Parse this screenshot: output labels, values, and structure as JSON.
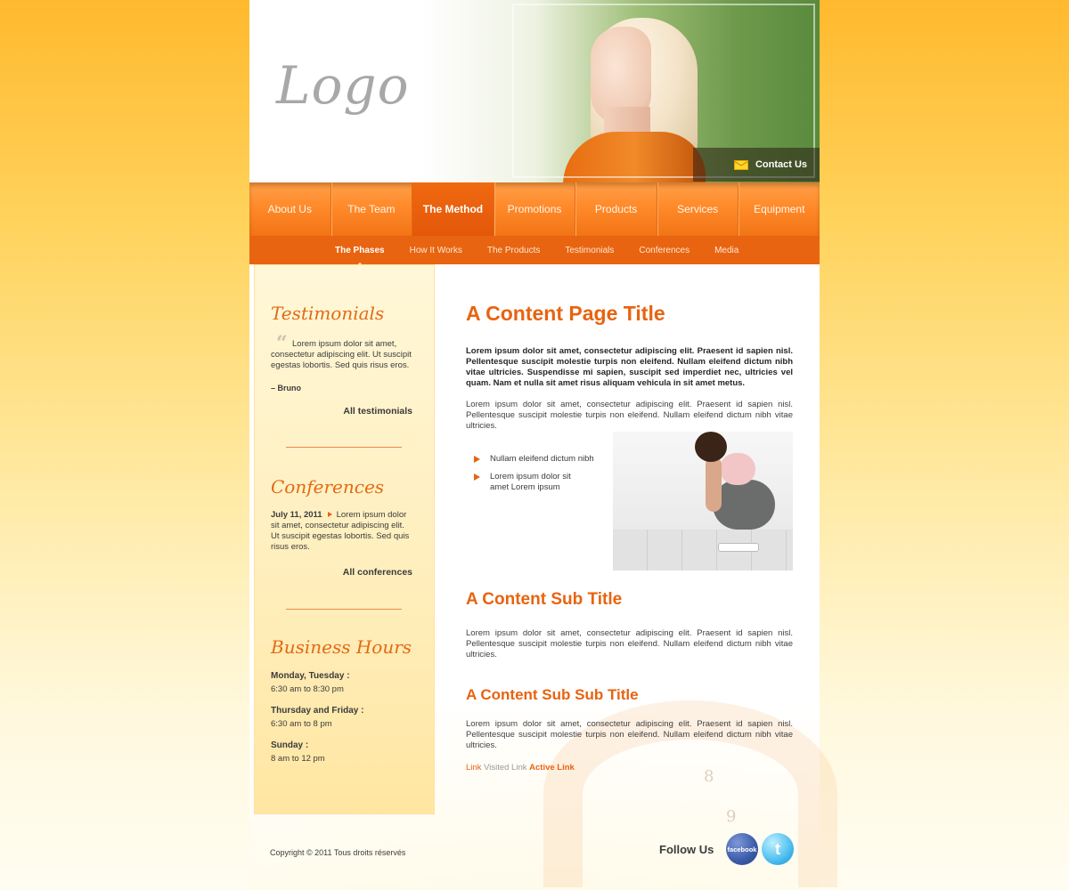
{
  "header": {
    "logo": "Logo",
    "contact_label": "Contact Us"
  },
  "nav": {
    "items": [
      {
        "label": "About Us"
      },
      {
        "label": "The Team"
      },
      {
        "label": "The Method"
      },
      {
        "label": "Promotions"
      },
      {
        "label": "Products"
      },
      {
        "label": "Services"
      },
      {
        "label": "Equipment"
      }
    ],
    "active": "The Method"
  },
  "subnav": {
    "items": [
      {
        "label": "The Phases"
      },
      {
        "label": "How It Works"
      },
      {
        "label": "The Products"
      },
      {
        "label": "Testimonials"
      },
      {
        "label": "Conferences"
      },
      {
        "label": "Media"
      }
    ],
    "active": "The Phases"
  },
  "sidebar": {
    "testimonials": {
      "title": "Testimonials",
      "quote_mark": "“",
      "text": "Lorem ipsum dolor sit amet, consectetur adipiscing elit. Ut suscipit egestas lobortis. Sed quis risus eros.",
      "author": "– Bruno",
      "link": "All testimonials"
    },
    "conferences": {
      "title": "Conferences",
      "date": "July 11, 2011",
      "text": "Lorem ipsum dolor sit amet, consectetur adipiscing elit. Ut suscipit egestas lobortis. Sed quis risus eros.",
      "link": "All conferences"
    },
    "hours": {
      "title": "Business Hours",
      "entries": [
        {
          "days": "Monday, Tuesday :",
          "time": "6:30 am to 8:30 pm"
        },
        {
          "days": "Thursday and Friday :",
          "time": "6:30 am to 8 pm"
        },
        {
          "days": "Sunday :",
          "time": "8 am to 12 pm"
        }
      ]
    }
  },
  "main": {
    "title": "A Content Page Title",
    "intro_bold": "Lorem ipsum dolor sit amet, consectetur adipiscing elit. Praesent id sapien nisl. Pellentesque suscipit molestie turpis non eleifend. Nullam eleifend dictum nibh vitae ultricies. Suspendisse mi sapien, suscipit sed imperdiet nec, ultricies vel quam. Nam et nulla sit amet risus aliquam vehicula in sit amet metus.",
    "intro": "Lorem ipsum dolor sit amet, consectetur adipiscing elit. Praesent id sapien nisl. Pellentesque suscipit molestie turpis non eleifend. Nullam eleifend dictum nibh vitae ultricies.",
    "bullets": [
      "Nullam eleifend dictum nibh",
      "Lorem ipsum dolor sit amet Lorem ipsum"
    ],
    "subtitle": "A Content Sub Title",
    "subtitle_text": "Lorem ipsum dolor sit amet, consectetur adipiscing elit. Praesent id sapien nisl. Pellentesque suscipit molestie turpis non eleifend. Nullam eleifend dictum nibh vitae ultricies.",
    "subsubtitle": "A Content Sub Sub Title",
    "subsubtitle_text": "Lorem ipsum dolor sit amet, consectetur adipiscing elit. Praesent id sapien nisl. Pellentesque suscipit molestie turpis non eleifend. Nullam eleifend dictum nibh vitae ultricies.",
    "links": {
      "link": "Link",
      "visited": "Visited Link",
      "active": "Active Link"
    }
  },
  "footer": {
    "copyright": "Copyright © 2011 Tous droits réservés",
    "follow": "Follow Us",
    "facebook": "facebook",
    "twitter": "t"
  },
  "decoration": {
    "tape_numbers": [
      "8",
      "9"
    ]
  },
  "colors": {
    "accent": "#e8630f",
    "nav": "#ff8a2a",
    "subnav": "#e86411"
  }
}
